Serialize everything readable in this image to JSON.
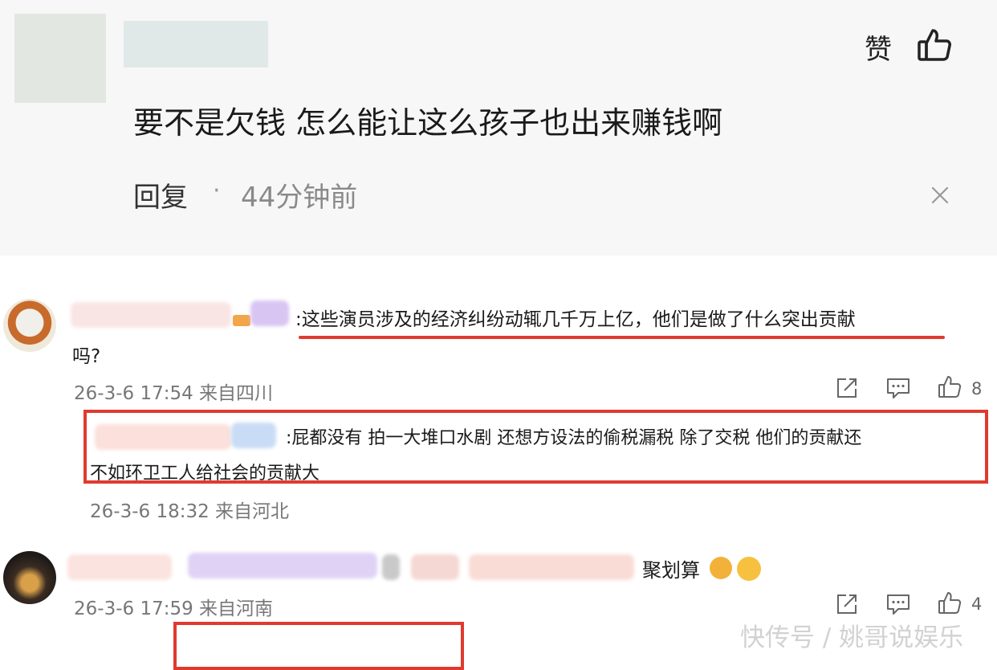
{
  "top_comment": {
    "like_label": "赞",
    "text": "要不是欠钱 怎么能让这么孩子也出来赚钱啊",
    "reply_label": "回复",
    "separator": "·",
    "time": "44分钟前"
  },
  "comments": [
    {
      "text": ":这些演员涉及的经济纠纷动辄几千万上亿，他们是做了什么突出贡献",
      "text_cont": "吗?",
      "meta": "26-3-6 17:54 来自四川",
      "likes": "8"
    },
    {
      "text": ":屁都没有 拍一大堆口水剧 还想方设法的偷税漏税 除了交税 他们的贡献还",
      "text_cont": "不如环卫工人给社会的贡献大",
      "meta": "26-3-6 18:32 来自河北"
    },
    {
      "text": "聚划算",
      "meta": "26-3-6 17:59 来自河南",
      "likes": "4"
    }
  ],
  "watermark": "快传号 / 姚哥说娱乐",
  "icons": [
    "thumbs-up-icon",
    "close-icon",
    "share-icon",
    "comment-icon",
    "like-icon"
  ],
  "colors": {
    "highlight_red": "#e03a2f",
    "muted_text": "#777777"
  }
}
